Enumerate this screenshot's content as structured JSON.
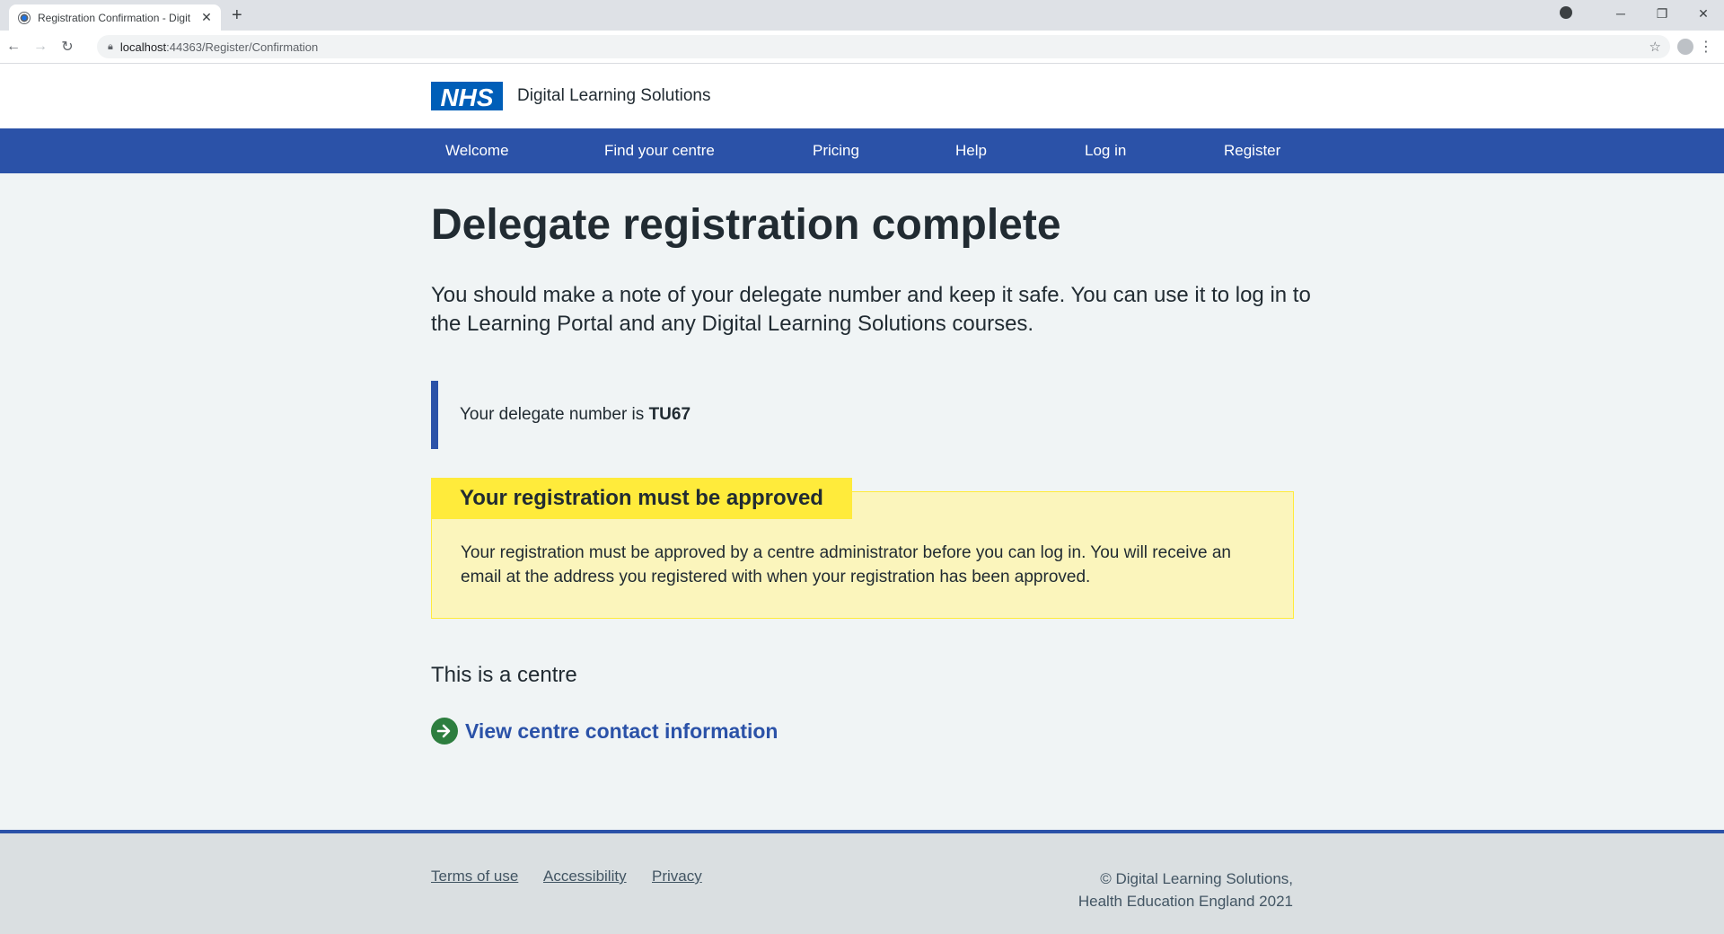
{
  "browser": {
    "tab_title": "Registration Confirmation - Digit",
    "tab_close": "✕",
    "new_tab": "+",
    "url_host": "localhost",
    "url_path": ":44363/Register/Confirmation",
    "back": "←",
    "forward": "→",
    "reload": "↻",
    "star": "☆",
    "minimize": "─",
    "restore": "❐",
    "close": "✕",
    "menu": "⋮"
  },
  "header": {
    "logo_text": "NHS",
    "service_name": "Digital Learning Solutions"
  },
  "nav": {
    "items": [
      "Welcome",
      "Find your centre",
      "Pricing",
      "Help",
      "Log in",
      "Register"
    ]
  },
  "main": {
    "title": "Delegate registration complete",
    "lede": "You should make a note of your delegate number and keep it safe. You can use it to log in to the Learning Portal and any Digital Learning Solutions courses.",
    "inset_prefix": "Your delegate number is ",
    "delegate_number": "TU67",
    "warning_heading": "Your registration must be approved",
    "warning_body": "Your registration must be approved by a centre administrator before you can log in. You will receive an email at the address you registered with when your registration has been approved.",
    "centre_text": "This is a centre",
    "action_link": "View centre contact information"
  },
  "footer": {
    "links": [
      "Terms of use",
      "Accessibility",
      "Privacy"
    ],
    "copyright_line1": "© Digital Learning Solutions,",
    "copyright_line2": "Health Education England 2021"
  },
  "colors": {
    "nav_blue": "#2b52a8",
    "nhs_blue": "#005eb8",
    "warning_yellow": "#ffeb3b",
    "action_green": "#2d7e3f"
  }
}
